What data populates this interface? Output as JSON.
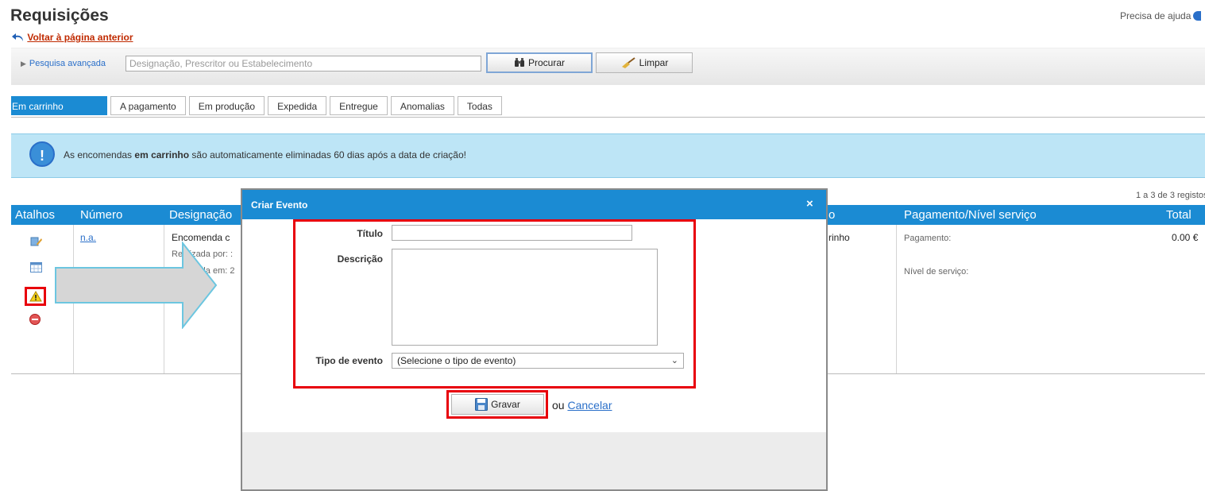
{
  "header": {
    "title": "Requisições",
    "back_link": "Voltar à página anterior",
    "help": "Precisa de ajuda"
  },
  "search": {
    "advanced": "Pesquisa avançada",
    "placeholder": "Designação, Prescritor ou Estabelecimento",
    "search_btn": "Procurar",
    "clear_btn": "Limpar"
  },
  "tabs": [
    "Em carrinho",
    "A pagamento",
    "Em produção",
    "Expedida",
    "Entregue",
    "Anomalias",
    "Todas"
  ],
  "notice": {
    "before": "As encomendas ",
    "bold": "em carrinho",
    "after": " são automaticamente eliminadas 60 dias após a data de criação!"
  },
  "table": {
    "records": "1 a 3 de 3 registos",
    "columns": {
      "shortcuts": "Atalhos",
      "number": "Número",
      "designation": "Designação",
      "state_tail": "o",
      "payment": "Pagamento/Nível serviço",
      "total": "Total"
    },
    "row": {
      "number": "n.a.",
      "designation": "Encomenda c",
      "made_by": "Realizada por: :",
      "made_on": "Realizada em: 2",
      "state": "rinho",
      "payment": "Pagamento:",
      "service_level": "Nível de serviço:",
      "total": "0.00 €"
    }
  },
  "dialog": {
    "title": "Criar Evento",
    "close": "×",
    "title_label": "Título",
    "title_value": "",
    "description_label": "Descrição",
    "description_value": "",
    "type_label": "Tipo de evento",
    "type_selected": "(Selecione o tipo de evento)",
    "save": "Gravar",
    "or": "ou",
    "cancel": "Cancelar"
  },
  "colors": {
    "accent": "#1b8bd3",
    "highlight": "#e8000b",
    "notice_bg": "#bde5f6"
  }
}
